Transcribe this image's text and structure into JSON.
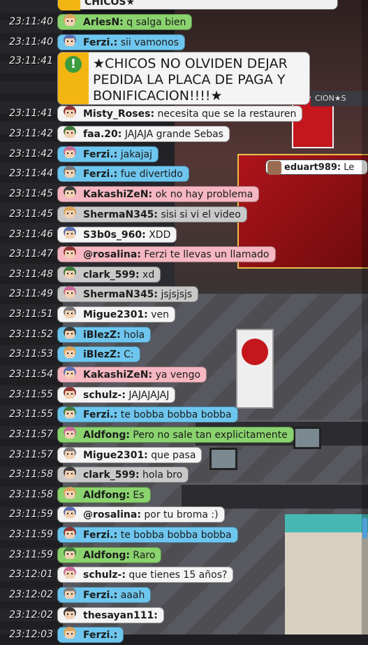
{
  "banner_top": {
    "text": "CHICOS★"
  },
  "alert": {
    "icon": "exclamation-icon",
    "text": "★CHICOS NO OLVIDEN DEJAR PEDIDA LA PLACA DE PAGA Y BONIFICACION!!!!★",
    "time": "23:11:41"
  },
  "room_bubbles": {
    "eduart": {
      "user": "eduart989:",
      "text": "Le"
    },
    "banner_label": "CION★S"
  },
  "messages": [
    {
      "time": "23:11:40",
      "user": "ArlesN:",
      "text": "q salga bien",
      "color": "#8ad36e"
    },
    {
      "time": "23:11:40",
      "user": "Ferzi.:",
      "text": "sii vamonos",
      "color": "#6ec6ee"
    },
    {
      "time": "23:11:41",
      "user": "Misty_Roses:",
      "text": "necesita que se la restauren",
      "color": "#f4f4f4"
    },
    {
      "time": "23:11:42",
      "user": "faa.20:",
      "text": "JAJAJA grande Sebas",
      "color": "#f4f4f4"
    },
    {
      "time": "23:11:42",
      "user": "Ferzi.:",
      "text": "jakajaj",
      "color": "#6ec6ee"
    },
    {
      "time": "23:11:44",
      "user": "Ferzi.:",
      "text": "fue divertido",
      "color": "#6ec6ee"
    },
    {
      "time": "23:11:45",
      "user": "KakashiZeN:",
      "text": "ok no hay problema",
      "color": "#f6b7c2"
    },
    {
      "time": "23:11:45",
      "user": "ShermaN345:",
      "text": "sisi si vi el video",
      "color": "#c9c9c9"
    },
    {
      "time": "23:11:46",
      "user": "S3b0s_960:",
      "text": "XDD",
      "color": "#f4f4f4"
    },
    {
      "time": "23:11:47",
      "user": "@rosalina:",
      "text": "Ferzi te llevas un llamado",
      "color": "#f6b7c2"
    },
    {
      "time": "23:11:48",
      "user": "clark_599:",
      "text": "xd",
      "color": "#c9c9c9"
    },
    {
      "time": "23:11:49",
      "user": "ShermaN345:",
      "text": "jsjsjsjs",
      "color": "#c9c9c9"
    },
    {
      "time": "23:11:51",
      "user": "Migue2301:",
      "text": "ven",
      "color": "#f4f4f4"
    },
    {
      "time": "23:11:52",
      "user": "iBlezZ:",
      "text": "hola",
      "color": "#6ec6ee"
    },
    {
      "time": "23:11:53",
      "user": "iBlezZ:",
      "text": "C:",
      "color": "#6ec6ee"
    },
    {
      "time": "23:11:54",
      "user": "KakashiZeN:",
      "text": "ya vengo",
      "color": "#f6b7c2"
    },
    {
      "time": "23:11:55",
      "user": "schulz-:",
      "text": "JAJAJAJAJ",
      "color": "#f4f4f4"
    },
    {
      "time": "23:11:55",
      "user": "Ferzi.:",
      "text": "te bobba bobba bobba",
      "color": "#6ec6ee"
    },
    {
      "time": "23:11:57",
      "user": "Aldfong:",
      "text": "Pero no sale tan explicitamente",
      "color": "#8ad36e"
    },
    {
      "time": "23:11:57",
      "user": "Migue2301:",
      "text": "que pasa",
      "color": "#f4f4f4"
    },
    {
      "time": "23:11:58",
      "user": "clark_599:",
      "text": "hola bro",
      "color": "#c9c9c9"
    },
    {
      "time": "23:11:58",
      "user": "Aldfong:",
      "text": "Es",
      "color": "#8ad36e"
    },
    {
      "time": "23:11:59",
      "user": "@rosalina:",
      "text": "por tu broma :)",
      "color": "#f4f4f4"
    },
    {
      "time": "23:11:59",
      "user": "Ferzi.:",
      "text": "te bobba bobba bobba",
      "color": "#6ec6ee"
    },
    {
      "time": "23:11:59",
      "user": "Aldfong:",
      "text": "Raro",
      "color": "#8ad36e"
    },
    {
      "time": "23:12:01",
      "user": "schulz-:",
      "text": "que tienes 15 años?",
      "color": "#f4f4f4"
    },
    {
      "time": "23:12:02",
      "user": "Ferzi.:",
      "text": "aaah",
      "color": "#6ec6ee"
    },
    {
      "time": "23:12:02",
      "user": "thesayan111:",
      "text": "",
      "color": "#f4f4f4"
    },
    {
      "time": "23:12:03",
      "user": "Ferzi.:",
      "text": "",
      "color": "#6ec6ee"
    }
  ]
}
